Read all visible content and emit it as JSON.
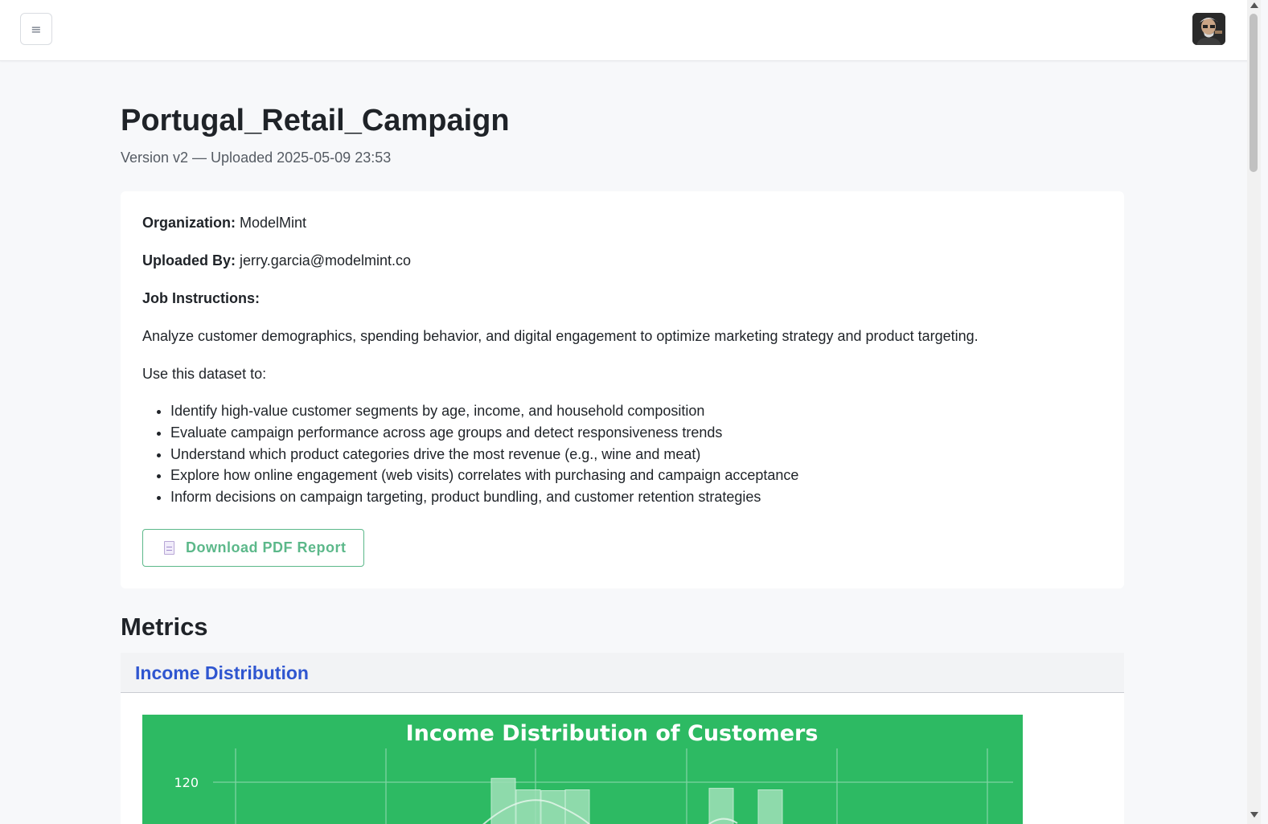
{
  "header": {
    "menu_icon": "hamburger-menu-icon",
    "menu_glyph": "≡",
    "avatar_icon": "user-avatar"
  },
  "page": {
    "title": "Portugal_Retail_Campaign",
    "subtitle": "Version v2 — Uploaded 2025-05-09 23:53"
  },
  "info": {
    "organization_label": "Organization:",
    "organization_value": "ModelMint",
    "uploaded_by_label": "Uploaded By:",
    "uploaded_by_value": "jerry.garcia@modelmint.co",
    "job_instructions_label": "Job Instructions:",
    "description": "Analyze customer demographics, spending behavior, and digital engagement to optimize marketing strategy and product targeting.",
    "use_intro": "Use this dataset to:",
    "bullets": [
      "Identify high-value customer segments by age, income, and household composition",
      "Evaluate campaign performance across age groups and detect responsiveness trends",
      "Understand which product categories drive the most revenue (e.g., wine and meat)",
      "Explore how online engagement (web visits) correlates with purchasing and campaign acceptance",
      "Inform decisions on campaign targeting, product bundling, and customer retention strategies"
    ],
    "download_label": "Download PDF Report",
    "download_icon": "document-icon"
  },
  "metrics": {
    "section_title": "Metrics",
    "income_title": "Income Distribution"
  },
  "colors": {
    "chart_bg": "#2dba63",
    "link_blue": "#2f56d0",
    "button_green": "#5cb88a"
  },
  "chart_data": {
    "type": "bar",
    "title": "Income Distribution of Customers",
    "yticks": [
      120
    ],
    "visible_bars": [
      {
        "height": 125
      },
      {
        "height": 110
      },
      {
        "height": 109
      },
      {
        "height": 110
      },
      {
        "height": 112
      },
      {
        "height": 110
      }
    ],
    "note_visible_portion": "chart is cut off by the viewport; only top portion visible",
    "grid": true
  }
}
